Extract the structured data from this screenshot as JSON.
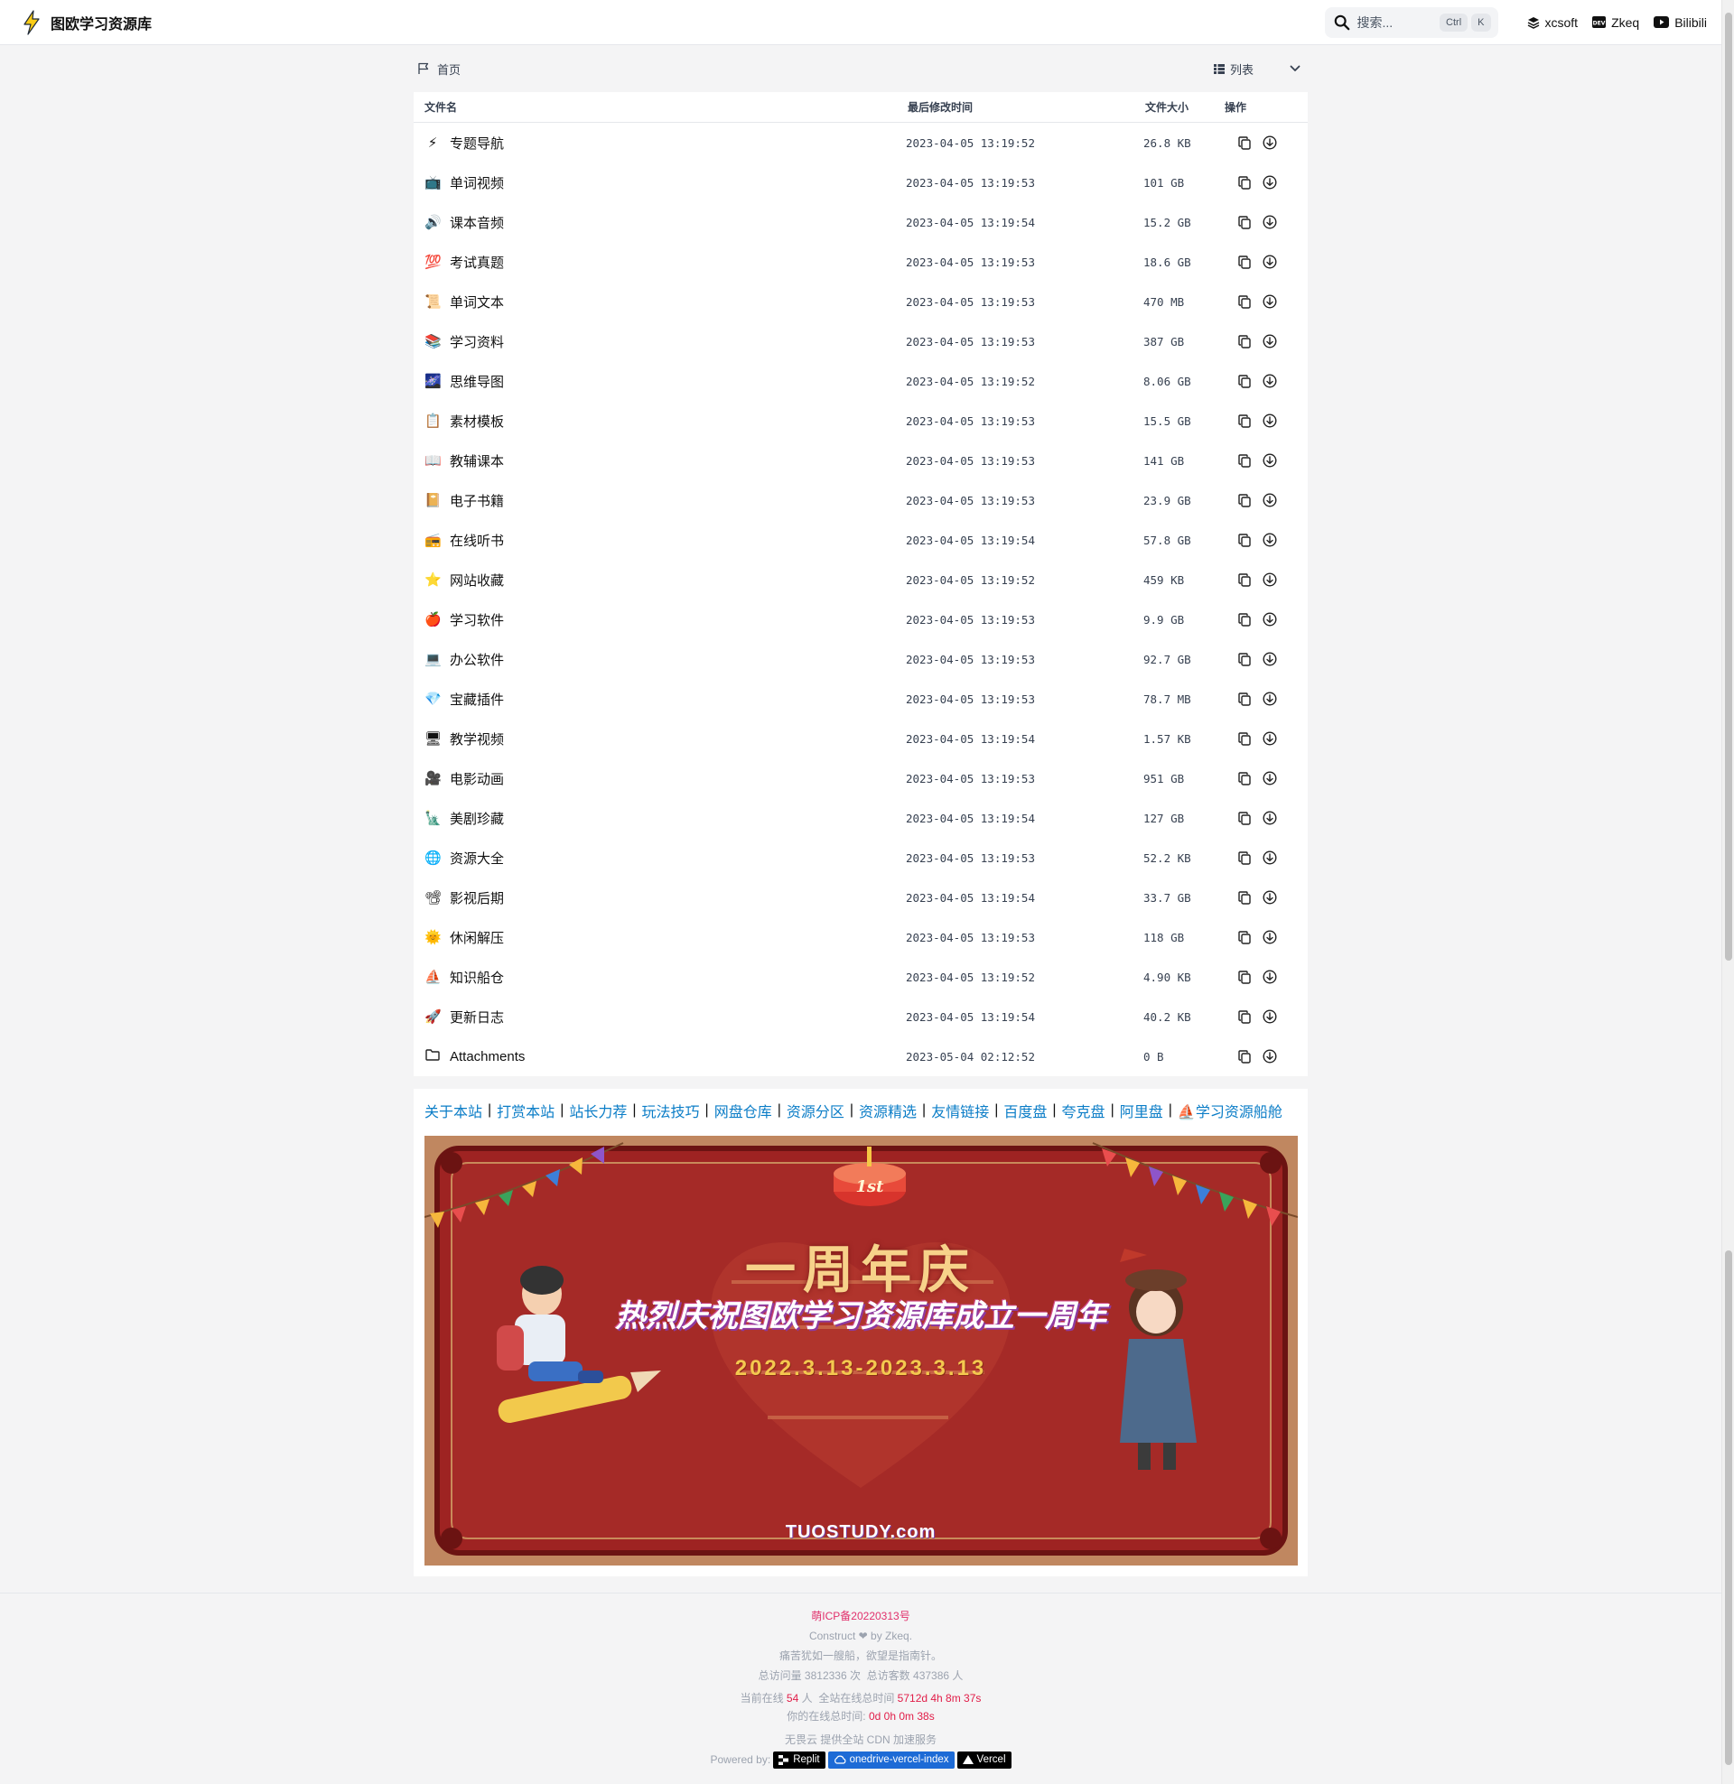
{
  "header": {
    "title": "图欧学习资源库",
    "search_placeholder": "搜索...",
    "shortcut_ctrl": "Ctrl",
    "shortcut_k": "K",
    "links": [
      {
        "label": "xcsoft",
        "icon": "layers-icon"
      },
      {
        "label": "Zkeq",
        "icon": "dev-icon"
      },
      {
        "label": "Bilibili",
        "icon": "youtube-icon"
      }
    ]
  },
  "breadcrumb": {
    "home": "首页"
  },
  "view": {
    "label": "列表"
  },
  "columns": {
    "name": "文件名",
    "modified": "最后修改时间",
    "size": "文件大小",
    "actions": "操作"
  },
  "files": [
    {
      "emoji": "⚡",
      "name": "专题导航",
      "modified": "2023-04-05 13:19:52",
      "size": "26.8 KB"
    },
    {
      "emoji": "📺",
      "name": "单词视频",
      "modified": "2023-04-05 13:19:53",
      "size": "101 GB"
    },
    {
      "emoji": "🔊",
      "name": "课本音频",
      "modified": "2023-04-05 13:19:54",
      "size": "15.2 GB"
    },
    {
      "emoji": "💯",
      "name": "考试真题",
      "modified": "2023-04-05 13:19:53",
      "size": "18.6 GB"
    },
    {
      "emoji": "📜",
      "name": "单词文本",
      "modified": "2023-04-05 13:19:53",
      "size": "470 MB"
    },
    {
      "emoji": "📚",
      "name": "学习资料",
      "modified": "2023-04-05 13:19:53",
      "size": "387 GB"
    },
    {
      "emoji": "🌌",
      "name": "思维导图",
      "modified": "2023-04-05 13:19:52",
      "size": "8.06 GB"
    },
    {
      "emoji": "📋",
      "name": "素材模板",
      "modified": "2023-04-05 13:19:53",
      "size": "15.5 GB"
    },
    {
      "emoji": "📖",
      "name": "教辅课本",
      "modified": "2023-04-05 13:19:53",
      "size": "141 GB"
    },
    {
      "emoji": "📔",
      "name": "电子书籍",
      "modified": "2023-04-05 13:19:53",
      "size": "23.9 GB"
    },
    {
      "emoji": "📻",
      "name": "在线听书",
      "modified": "2023-04-05 13:19:54",
      "size": "57.8 GB"
    },
    {
      "emoji": "⭐",
      "name": "网站收藏",
      "modified": "2023-04-05 13:19:52",
      "size": "459 KB"
    },
    {
      "emoji": "🍎",
      "name": "学习软件",
      "modified": "2023-04-05 13:19:53",
      "size": "9.9 GB"
    },
    {
      "emoji": "💻",
      "name": "办公软件",
      "modified": "2023-04-05 13:19:53",
      "size": "92.7 GB"
    },
    {
      "emoji": "💎",
      "name": "宝藏插件",
      "modified": "2023-04-05 13:19:53",
      "size": "78.7 MB"
    },
    {
      "emoji": "🖥",
      "name": "教学视频",
      "modified": "2023-04-05 13:19:54",
      "size": "1.57 KB"
    },
    {
      "emoji": "🎥",
      "name": "电影动画",
      "modified": "2023-04-05 13:19:53",
      "size": "951 GB"
    },
    {
      "emoji": "🗽",
      "name": "美剧珍藏",
      "modified": "2023-04-05 13:19:54",
      "size": "127 GB"
    },
    {
      "emoji": "🌐",
      "name": "资源大全",
      "modified": "2023-04-05 13:19:53",
      "size": "52.2 KB"
    },
    {
      "emoji": "📽",
      "name": "影视后期",
      "modified": "2023-04-05 13:19:54",
      "size": "33.7 GB"
    },
    {
      "emoji": "🌞",
      "name": "休闲解压",
      "modified": "2023-04-05 13:19:53",
      "size": "118 GB"
    },
    {
      "emoji": "⛵",
      "name": "知识船仓",
      "modified": "2023-04-05 13:19:52",
      "size": "4.90 KB"
    },
    {
      "emoji": "🚀",
      "name": "更新日志",
      "modified": "2023-04-05 13:19:54",
      "size": "40.2 KB"
    },
    {
      "emoji": "folder-icon",
      "name": "Attachments",
      "modified": "2023-05-04 02:12:52",
      "size": "0 B"
    }
  ],
  "readme_links": [
    "关于本站",
    "打赏本站",
    "站长力荐",
    "玩法技巧",
    "网盘仓库",
    "资源分区",
    "资源精选",
    "友情链接",
    "百度盘",
    "夸克盘",
    "阿里盘",
    "⛵学习资源船舱"
  ],
  "banner": {
    "badge": "1st",
    "heading": "一周年庆",
    "subtitle": "热烈庆祝图欧学习资源库成立一周年",
    "dates": "2022.3.13-2023.3.13",
    "domain": "TUOSTUDY.com"
  },
  "footer": {
    "icp": "萌ICP备20220313号",
    "construct": "Construct ❤ by Zkeq.",
    "motto": "痛苦犹如一艘船，欲望是指南针。",
    "visits_prefix": "总访问量",
    "visits": "3812336",
    "visits_unit": "次",
    "visitors_prefix": "总访客数",
    "visitors": "437386",
    "visitors_unit": "人",
    "online_prefix": "当前在线",
    "online": "54",
    "online_unit": "人",
    "site_time_prefix": "全站在线总时间",
    "site_time": "5712d 4h 8m 37s",
    "your_time_prefix": "你的在线总时间:",
    "your_time": "0d 0h 0m 38s",
    "cdn": "无畏云 提供全站 CDN 加速服务",
    "powered": "Powered by:",
    "badges": [
      "Replit",
      "onedrive-vercel-index",
      "Vercel"
    ]
  },
  "colors": {
    "link": "#0b7dc7",
    "icp": "#e1306c",
    "stat_red": "#e11d48"
  }
}
